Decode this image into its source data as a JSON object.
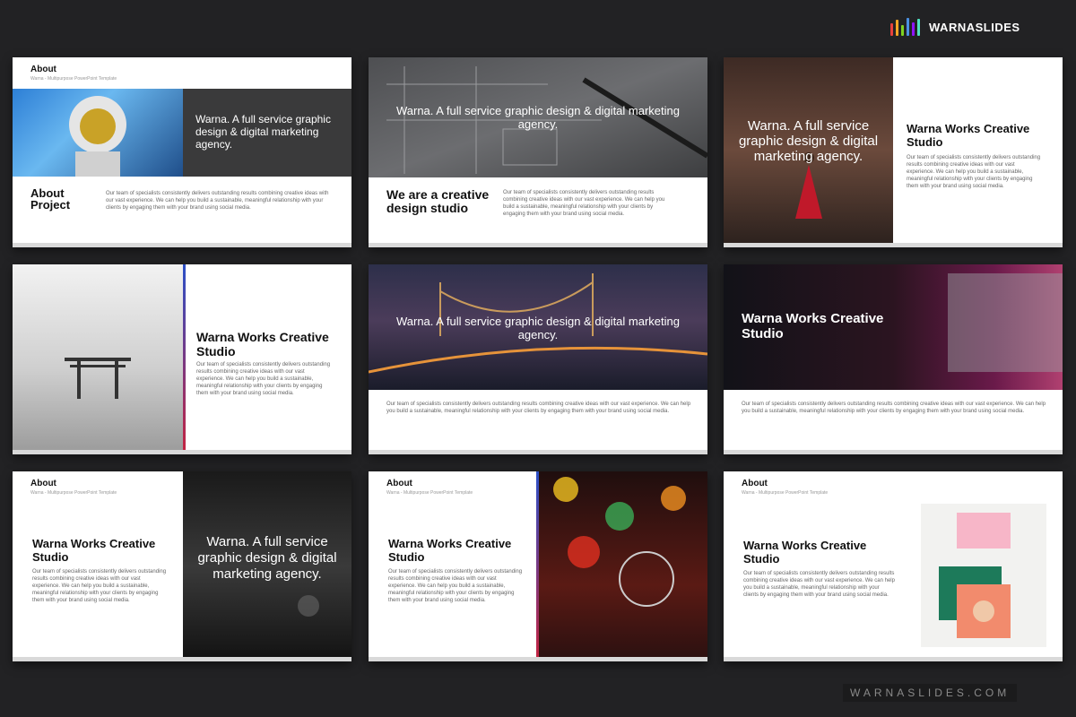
{
  "brand": {
    "name": "WARNASLIDES",
    "colors": [
      "#e8413c",
      "#f5a623",
      "#7ed321",
      "#4a90e2",
      "#9013fe",
      "#50e3c2"
    ]
  },
  "watermark": "WARNASLIDES.COM",
  "slides": [
    {
      "label": "About",
      "sub": "Warna - Multipurpose PowerPoint Template",
      "overlay": "Warna. A full service graphic design & digital marketing agency.",
      "heading": "About Project",
      "body": "Our team of specialists consistently delivers outstanding results combining creative ideas with our vast experience. We can help you build a sustainable, meaningful relationship with your clients by engaging them with your brand using social media."
    },
    {
      "overlay": "Warna. A full service graphic design & digital marketing agency.",
      "heading": "We are a creative design studio",
      "body": "Our team of specialists consistently delivers outstanding results combining creative ideas with our vast experience. We can help you build a sustainable, meaningful relationship with your clients by engaging them with your brand using social media."
    },
    {
      "overlay": "Warna. A full service graphic design & digital marketing agency.",
      "heading": "Warna Works Creative Studio",
      "body": "Our team of specialists consistently delivers outstanding results combining creative ideas with our vast experience. We can help you build a sustainable, meaningful relationship with your clients by engaging them with your brand using social media."
    },
    {
      "heading": "Warna Works Creative Studio",
      "body": "Our team of specialists consistently delivers outstanding results combining creative ideas with our vast experience. We can help you build a sustainable, meaningful relationship with your clients by engaging them with your brand using social media."
    },
    {
      "overlay": "Warna. A full service graphic design & digital marketing agency.",
      "body": "Our team of specialists consistently delivers outstanding results combining creative ideas with our vast experience. We can help you build a sustainable, meaningful relationship with your clients by engaging them with your brand using social media."
    },
    {
      "overlay": "Warna Works Creative Studio",
      "body": "Our team of specialists consistently delivers outstanding results combining creative ideas with our vast experience. We can help you build a sustainable, meaningful relationship with your clients by engaging them with your brand using social media."
    },
    {
      "label": "About",
      "sub": "Warna - Multipurpose PowerPoint Template",
      "overlay": "Warna. A full service graphic design & digital marketing agency.",
      "heading": "Warna Works Creative Studio",
      "body": "Our team of specialists consistently delivers outstanding results combining creative ideas with our vast experience. We can help you build a sustainable, meaningful relationship with your clients by engaging them with your brand using social media."
    },
    {
      "label": "About",
      "sub": "Warna - Multipurpose PowerPoint Template",
      "heading": "Warna Works Creative Studio",
      "body": "Our team of specialists consistently delivers outstanding results combining creative ideas with our vast experience. We can help you build a sustainable, meaningful relationship with your clients by engaging them with your brand using social media."
    },
    {
      "label": "About",
      "sub": "Warna - Multipurpose PowerPoint Template",
      "heading": "Warna Works Creative Studio",
      "body": "Our team of specialists consistently delivers outstanding results combining creative ideas with our vast experience. We can help you build a sustainable, meaningful relationship with your clients by engaging them with your brand using social media."
    }
  ]
}
